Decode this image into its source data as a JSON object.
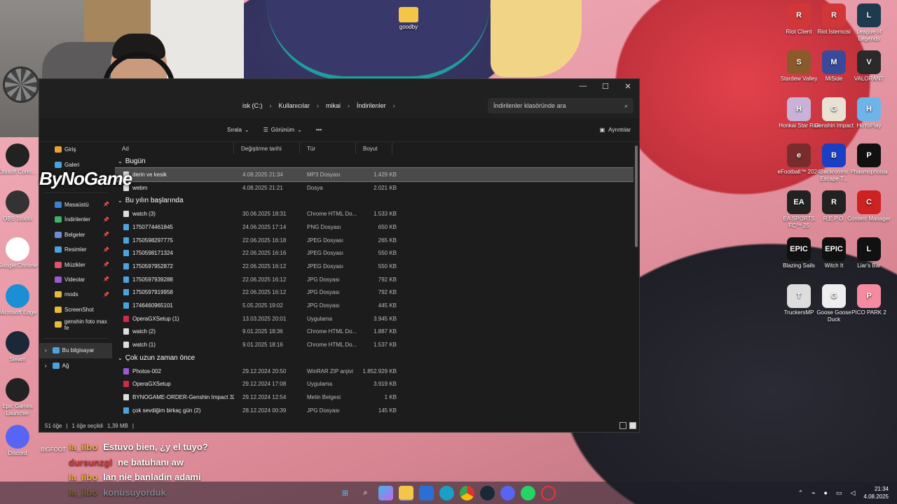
{
  "desktop": {
    "top_folder": "goodby",
    "left_icons": [
      "Ubisoft Conn...",
      "OBS Studio",
      "Google Chrome",
      "Microsoft Edge",
      "Steam",
      "Epic Games Launcher",
      "Discord"
    ],
    "right_icons": [
      {
        "label": "Riot Client",
        "color": "#d13639",
        "glyph": "R"
      },
      {
        "label": "Riot İstemcisi",
        "color": "#d13639",
        "glyph": "R"
      },
      {
        "label": "League of Legends",
        "color": "#1e3a4e",
        "glyph": "L"
      },
      {
        "label": "Stardew Valley",
        "color": "#8a5a2b",
        "glyph": "S"
      },
      {
        "label": "MiSide",
        "color": "#3a4a9a",
        "glyph": "M"
      },
      {
        "label": "VALORANT",
        "color": "#2a2a2a",
        "glyph": "V"
      },
      {
        "label": "Honkai Star Rail",
        "color": "#c9b2d8",
        "glyph": "H"
      },
      {
        "label": "Genshin Impact",
        "color": "#e9e1d2",
        "glyph": "G"
      },
      {
        "label": "HoYoPlay",
        "color": "#6db4e8",
        "glyph": "H"
      },
      {
        "label": "eFootball™ 2024",
        "color": "#7a2b2b",
        "glyph": "e"
      },
      {
        "label": "Backrooms Escape T...",
        "color": "#1a3fc4",
        "glyph": "B"
      },
      {
        "label": "Phasmophobia",
        "color": "#111",
        "glyph": "P"
      },
      {
        "label": "EA SPORTS FC™ 25",
        "color": "#222",
        "glyph": "EA"
      },
      {
        "label": "R.E.P.O.",
        "color": "#222",
        "glyph": "R"
      },
      {
        "label": "Content Manager",
        "color": "#c22",
        "glyph": "C"
      },
      {
        "label": "Blazing Sails",
        "color": "#111",
        "glyph": "EPIC"
      },
      {
        "label": "Witch It",
        "color": "#111",
        "glyph": "EPIC"
      },
      {
        "label": "Liar's Bar",
        "color": "#111",
        "glyph": "L"
      },
      {
        "label": "TruckersMP",
        "color": "#ddd",
        "glyph": "T"
      },
      {
        "label": "Goose Goose Duck",
        "color": "#eee",
        "glyph": "G"
      },
      {
        "label": "PICO PARK 2",
        "color": "#f58ba0",
        "glyph": "P"
      }
    ]
  },
  "logo": "ByNoGame",
  "explorer": {
    "controls": [
      "—",
      "☐",
      "✕"
    ],
    "breadcrumbs": [
      "Yerel Disk (C:)",
      "Kullanıcılar",
      "mikai",
      "İndirilenler"
    ],
    "breadcrumb_first_visible": "isk (C:)",
    "search_placeholder": "İndirilenler klasöründe ara",
    "toolbar": {
      "sort": "Sırala",
      "view": "Görünüm",
      "more": "•••",
      "details": "Ayrıntılar"
    },
    "nav": [
      {
        "label": "Giriş",
        "color": "#e8a23a",
        "pin": false
      },
      {
        "label": "Galeri",
        "color": "#4aa3df",
        "pin": false
      },
      {
        "label": "Masaüstü",
        "color": "#3b82d6",
        "pin": true
      },
      {
        "label": "İndirilenler",
        "color": "#3bb36b",
        "pin": true
      },
      {
        "label": "Belgeler",
        "color": "#6b8cd6",
        "pin": true
      },
      {
        "label": "Resimler",
        "color": "#4aa3df",
        "pin": true
      },
      {
        "label": "Müzikler",
        "color": "#e0536b",
        "pin": true
      },
      {
        "label": "Videolar",
        "color": "#9b59d6",
        "pin": true
      },
      {
        "label": "mods",
        "color": "#e8b93a",
        "pin": true
      },
      {
        "label": "ScreenShot",
        "color": "#e8b93a",
        "pin": false
      },
      {
        "label": "genshin foto max fe",
        "color": "#e8b93a",
        "pin": false
      }
    ],
    "nav_bottom": [
      "Bu bilgisayar",
      "Ağ"
    ],
    "columns": [
      "Ad",
      "Değiştirme tarihi",
      "Tür",
      "Boyut"
    ],
    "groups": [
      {
        "title": "Bugün",
        "rows": [
          {
            "name": "derin ve kesik",
            "date": "4.08.2025 21:34",
            "type": "MP3 Dosyası",
            "size": "1.429 KB",
            "icon": "#ddd",
            "sel": true
          },
          {
            "name": "webm",
            "date": "4.08.2025 21:21",
            "type": "Dosya",
            "size": "2.021 KB",
            "icon": "#ddd"
          }
        ]
      },
      {
        "title": "Bu yılın başlarında",
        "rows": [
          {
            "name": "watch (3)",
            "date": "30.06.2025 18:31",
            "type": "Chrome HTML Do...",
            "size": "1.533 KB",
            "icon": "#ddd"
          },
          {
            "name": "1750774461845",
            "date": "24.06.2025 17:14",
            "type": "PNG Dosyası",
            "size": "650 KB",
            "icon": "#4aa3df"
          },
          {
            "name": "1750598297775",
            "date": "22.06.2025 16:18",
            "type": "JPEG Dosyası",
            "size": "265 KB",
            "icon": "#4aa3df"
          },
          {
            "name": "1750598171324",
            "date": "22.06.2025 16:16",
            "type": "JPEG Dosyası",
            "size": "550 KB",
            "icon": "#4aa3df"
          },
          {
            "name": "1750597952872",
            "date": "22.06.2025 16:12",
            "type": "JPEG Dosyası",
            "size": "550 KB",
            "icon": "#4aa3df"
          },
          {
            "name": "1750597939288",
            "date": "22.06.2025 16:12",
            "type": "JPG Dosyası",
            "size": "792 KB",
            "icon": "#4aa3df"
          },
          {
            "name": "1750597919958",
            "date": "22.06.2025 16:12",
            "type": "JPG Dosyası",
            "size": "792 KB",
            "icon": "#4aa3df"
          },
          {
            "name": "1746460965101",
            "date": "5.05.2025 19:02",
            "type": "JPG Dosyası",
            "size": "445 KB",
            "icon": "#4aa3df"
          },
          {
            "name": "OperaGXSetup (1)",
            "date": "13.03.2025 20:01",
            "type": "Uygulama",
            "size": "3.945 KB",
            "icon": "#d1294a"
          },
          {
            "name": "watch (2)",
            "date": "9.01.2025 18:36",
            "type": "Chrome HTML Do...",
            "size": "1.887 KB",
            "icon": "#ddd"
          },
          {
            "name": "watch (1)",
            "date": "9.01.2025 18:16",
            "type": "Chrome HTML Do...",
            "size": "1.537 KB",
            "icon": "#ddd"
          }
        ]
      },
      {
        "title": "Çok uzun zaman önce",
        "rows": [
          {
            "name": "Photos-002",
            "date": "29.12.2024 20:50",
            "type": "WinRAR ZIP arşivi",
            "size": "1.852.929 KB",
            "icon": "#9b59d6"
          },
          {
            "name": "OperaGXSetup",
            "date": "29.12.2024 17:08",
            "type": "Uygulama",
            "size": "3.919 KB",
            "icon": "#d1294a"
          },
          {
            "name": "BYNOGAME-ORDER-Genshin Impact 328...",
            "date": "29.12.2024 12:54",
            "type": "Metin Belgesi",
            "size": "1 KB",
            "icon": "#ddd"
          },
          {
            "name": "çok sevdiğim birkaç gün (2)",
            "date": "28.12.2024 00:39",
            "type": "JPG Dosyası",
            "size": "145 KB",
            "icon": "#4aa3df"
          }
        ]
      }
    ],
    "status": {
      "count": "51 öğe",
      "selected": "1 öğe seçildi",
      "size": "1,39 MB"
    }
  },
  "chat": [
    {
      "user": "la_iibo",
      "msg": "Estuvo bien, ¿y el tuyo?",
      "alt": false
    },
    {
      "user": "dursunzgl",
      "msg": "ne batuhanı aw",
      "alt": true
    },
    {
      "user": "la_iibo",
      "msg": "lan nie banladin adami",
      "alt": false
    },
    {
      "user": "la_iibo",
      "msg": "konusuyorduk",
      "alt": false
    }
  ],
  "left_bottom_label": "BIGFOOT",
  "clock": {
    "time": "21:34",
    "date": "4.08.2025"
  }
}
